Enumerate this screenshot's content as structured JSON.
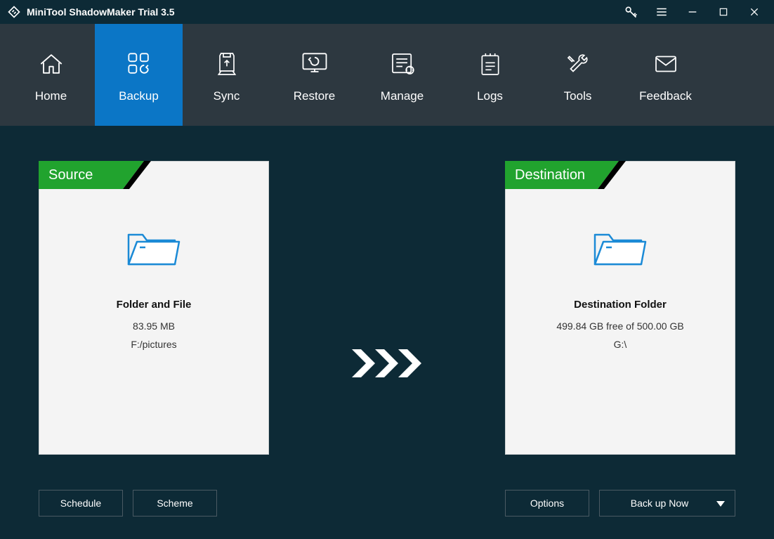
{
  "titlebar": {
    "title": "MiniTool ShadowMaker Trial 3.5"
  },
  "nav": {
    "items": [
      {
        "label": "Home"
      },
      {
        "label": "Backup"
      },
      {
        "label": "Sync"
      },
      {
        "label": "Restore"
      },
      {
        "label": "Manage"
      },
      {
        "label": "Logs"
      },
      {
        "label": "Tools"
      },
      {
        "label": "Feedback"
      }
    ],
    "activeIndex": 1
  },
  "source": {
    "tab": "Source",
    "title": "Folder and File",
    "size": "83.95 MB",
    "path": "F:/pictures"
  },
  "destination": {
    "tab": "Destination",
    "title": "Destination Folder",
    "free": "499.84 GB free of 500.00 GB",
    "path": "G:\\"
  },
  "buttons": {
    "schedule": "Schedule",
    "scheme": "Scheme",
    "options": "Options",
    "backup_now": "Back up Now"
  }
}
